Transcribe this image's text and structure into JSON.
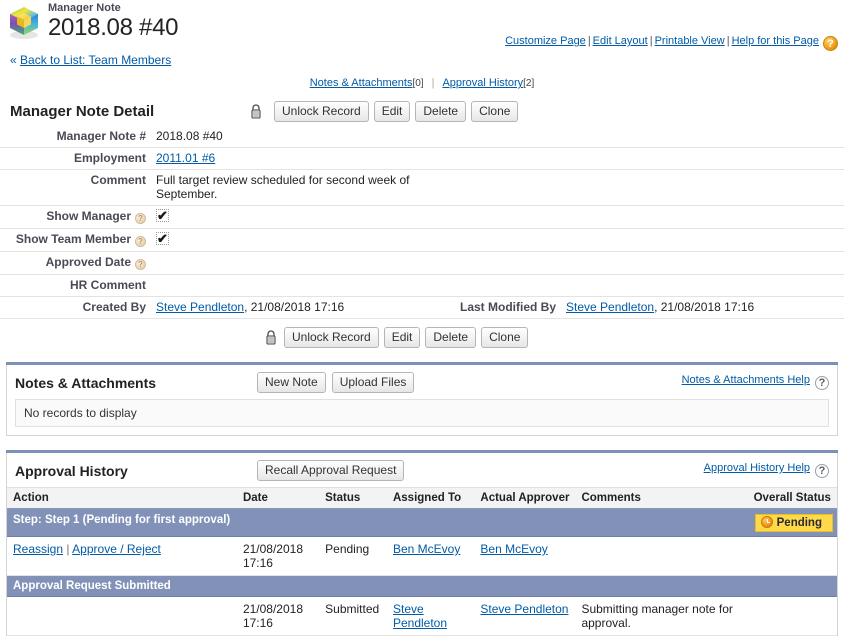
{
  "header": {
    "object_label": "Manager Note",
    "record_title": "2018.08 #40",
    "record_icon": "cube-icon",
    "utility_links": [
      {
        "label": "Customize Page",
        "name": "customize-page-link"
      },
      {
        "label": "Edit Layout",
        "name": "edit-layout-link"
      },
      {
        "label": "Printable View",
        "name": "printable-view-link"
      },
      {
        "label": "Help for this Page",
        "name": "help-for-this-page-link"
      }
    ],
    "separator": "|",
    "help_orb": "?",
    "back_chevron": "«",
    "back_label": "Back to List: Team Members"
  },
  "section_links": [
    {
      "label": "Notes & Attachments",
      "count": "[0]",
      "name": "jump-notes-attachments"
    },
    {
      "label": "Approval History",
      "count": "[2]",
      "name": "jump-approval-history"
    }
  ],
  "section_link_sep": "|",
  "detail": {
    "title": "Manager Note Detail",
    "lock_icon": "padlock-icon",
    "buttons": [
      {
        "label": "Unlock Record",
        "name": "unlock-record-button"
      },
      {
        "label": "Edit",
        "name": "edit-button"
      },
      {
        "label": "Delete",
        "name": "delete-button"
      },
      {
        "label": "Clone",
        "name": "clone-button"
      }
    ],
    "fields": {
      "manager_note_number": {
        "label": "Manager Note #",
        "value": "2018.08 #40"
      },
      "employment": {
        "label": "Employment",
        "value": "2011.01 #6"
      },
      "comment": {
        "label": "Comment",
        "value": "Full target review scheduled for second week of September."
      },
      "show_manager": {
        "label": "Show Manager",
        "value": "✔",
        "help": "?"
      },
      "show_team_member": {
        "label": "Show Team Member",
        "value": "✔",
        "help": "?"
      },
      "approved_date": {
        "label": "Approved Date",
        "value": "",
        "help": "?"
      },
      "hr_comment": {
        "label": "HR Comment",
        "value": ""
      },
      "created_by": {
        "label": "Created By",
        "user": "Steve Pendleton",
        "timestamp": ", 21/08/2018 17:16"
      },
      "last_modified_by": {
        "label": "Last Modified By",
        "user": "Steve Pendleton",
        "timestamp": ", 21/08/2018 17:16"
      }
    }
  },
  "notes_attachments": {
    "title": "Notes & Attachments",
    "buttons": [
      {
        "label": "New Note",
        "name": "new-note-button"
      },
      {
        "label": "Upload Files",
        "name": "upload-files-button"
      }
    ],
    "help_label": "Notes & Attachments Help",
    "help_orb": "?",
    "empty_message": "No records to display"
  },
  "approval_history": {
    "title": "Approval History",
    "buttons": [
      {
        "label": "Recall Approval Request",
        "name": "recall-approval-request-button"
      }
    ],
    "help_label": "Approval History Help",
    "help_orb": "?",
    "columns": [
      "Action",
      "Date",
      "Status",
      "Assigned To",
      "Actual Approver",
      "Comments",
      "Overall Status"
    ],
    "step_row_1": {
      "label": "Step: Step 1 (Pending for first approval)",
      "badge": "Pending",
      "badge_icon": "clock-icon"
    },
    "row_1": {
      "action_reassign": "Reassign",
      "action_sep": "|",
      "action_approve_reject": "Approve / Reject",
      "date": "21/08/2018 17:16",
      "status": "Pending",
      "assigned_to": "Ben McEvoy",
      "actual_approver": "Ben McEvoy",
      "comments": "",
      "overall_status": ""
    },
    "step_row_2": {
      "label": "Approval Request Submitted"
    },
    "row_2": {
      "action": "",
      "date": "21/08/2018 17:16",
      "status": "Submitted",
      "assigned_to": "Steve Pendleton",
      "actual_approver": "Steve Pendleton",
      "comments": "Submitting manager note for approval.",
      "overall_status": ""
    }
  },
  "colors": {
    "link": "#015ba7",
    "step_row_bg": "#8191b8",
    "badge_bg": "#ffd94a",
    "rule": "#7c91b7"
  }
}
